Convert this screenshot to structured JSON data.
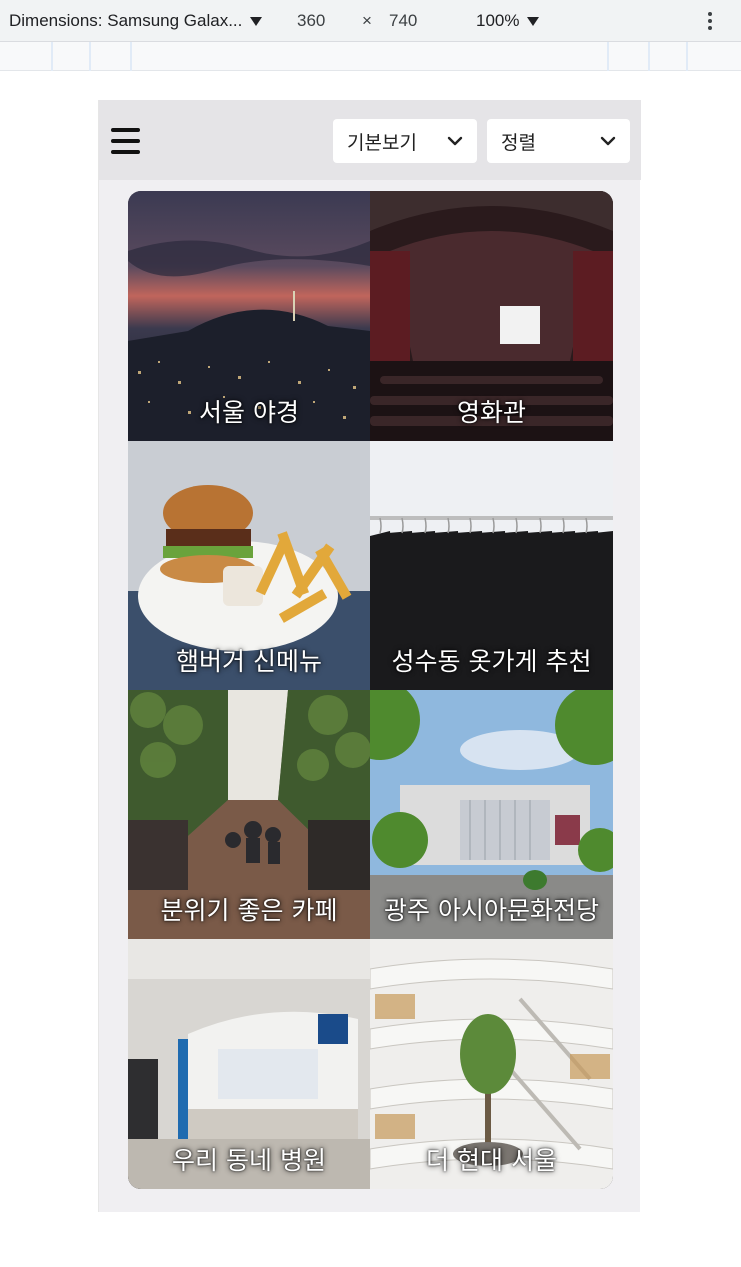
{
  "devtools": {
    "device": "Dimensions: Samsung Galax...",
    "width": "360",
    "times": "×",
    "height": "740",
    "zoom": "100%"
  },
  "app": {
    "view_dropdown": "기본보기",
    "sort_dropdown": "정렬",
    "cards": [
      {
        "title": "서울 야경"
      },
      {
        "title": "영화관"
      },
      {
        "title": "햄버거 신메뉴"
      },
      {
        "title": "성수동 옷가게 추천"
      },
      {
        "title": "분위기 좋은 카페"
      },
      {
        "title": "광주 아시아문화전당"
      },
      {
        "title": "우리 동네 병원"
      },
      {
        "title": "더 현대 서울"
      }
    ]
  },
  "icons": [
    "hamburger-menu-icon",
    "chevron-down-icon",
    "more-vert-icon",
    "dropdown-triangle-icon"
  ]
}
